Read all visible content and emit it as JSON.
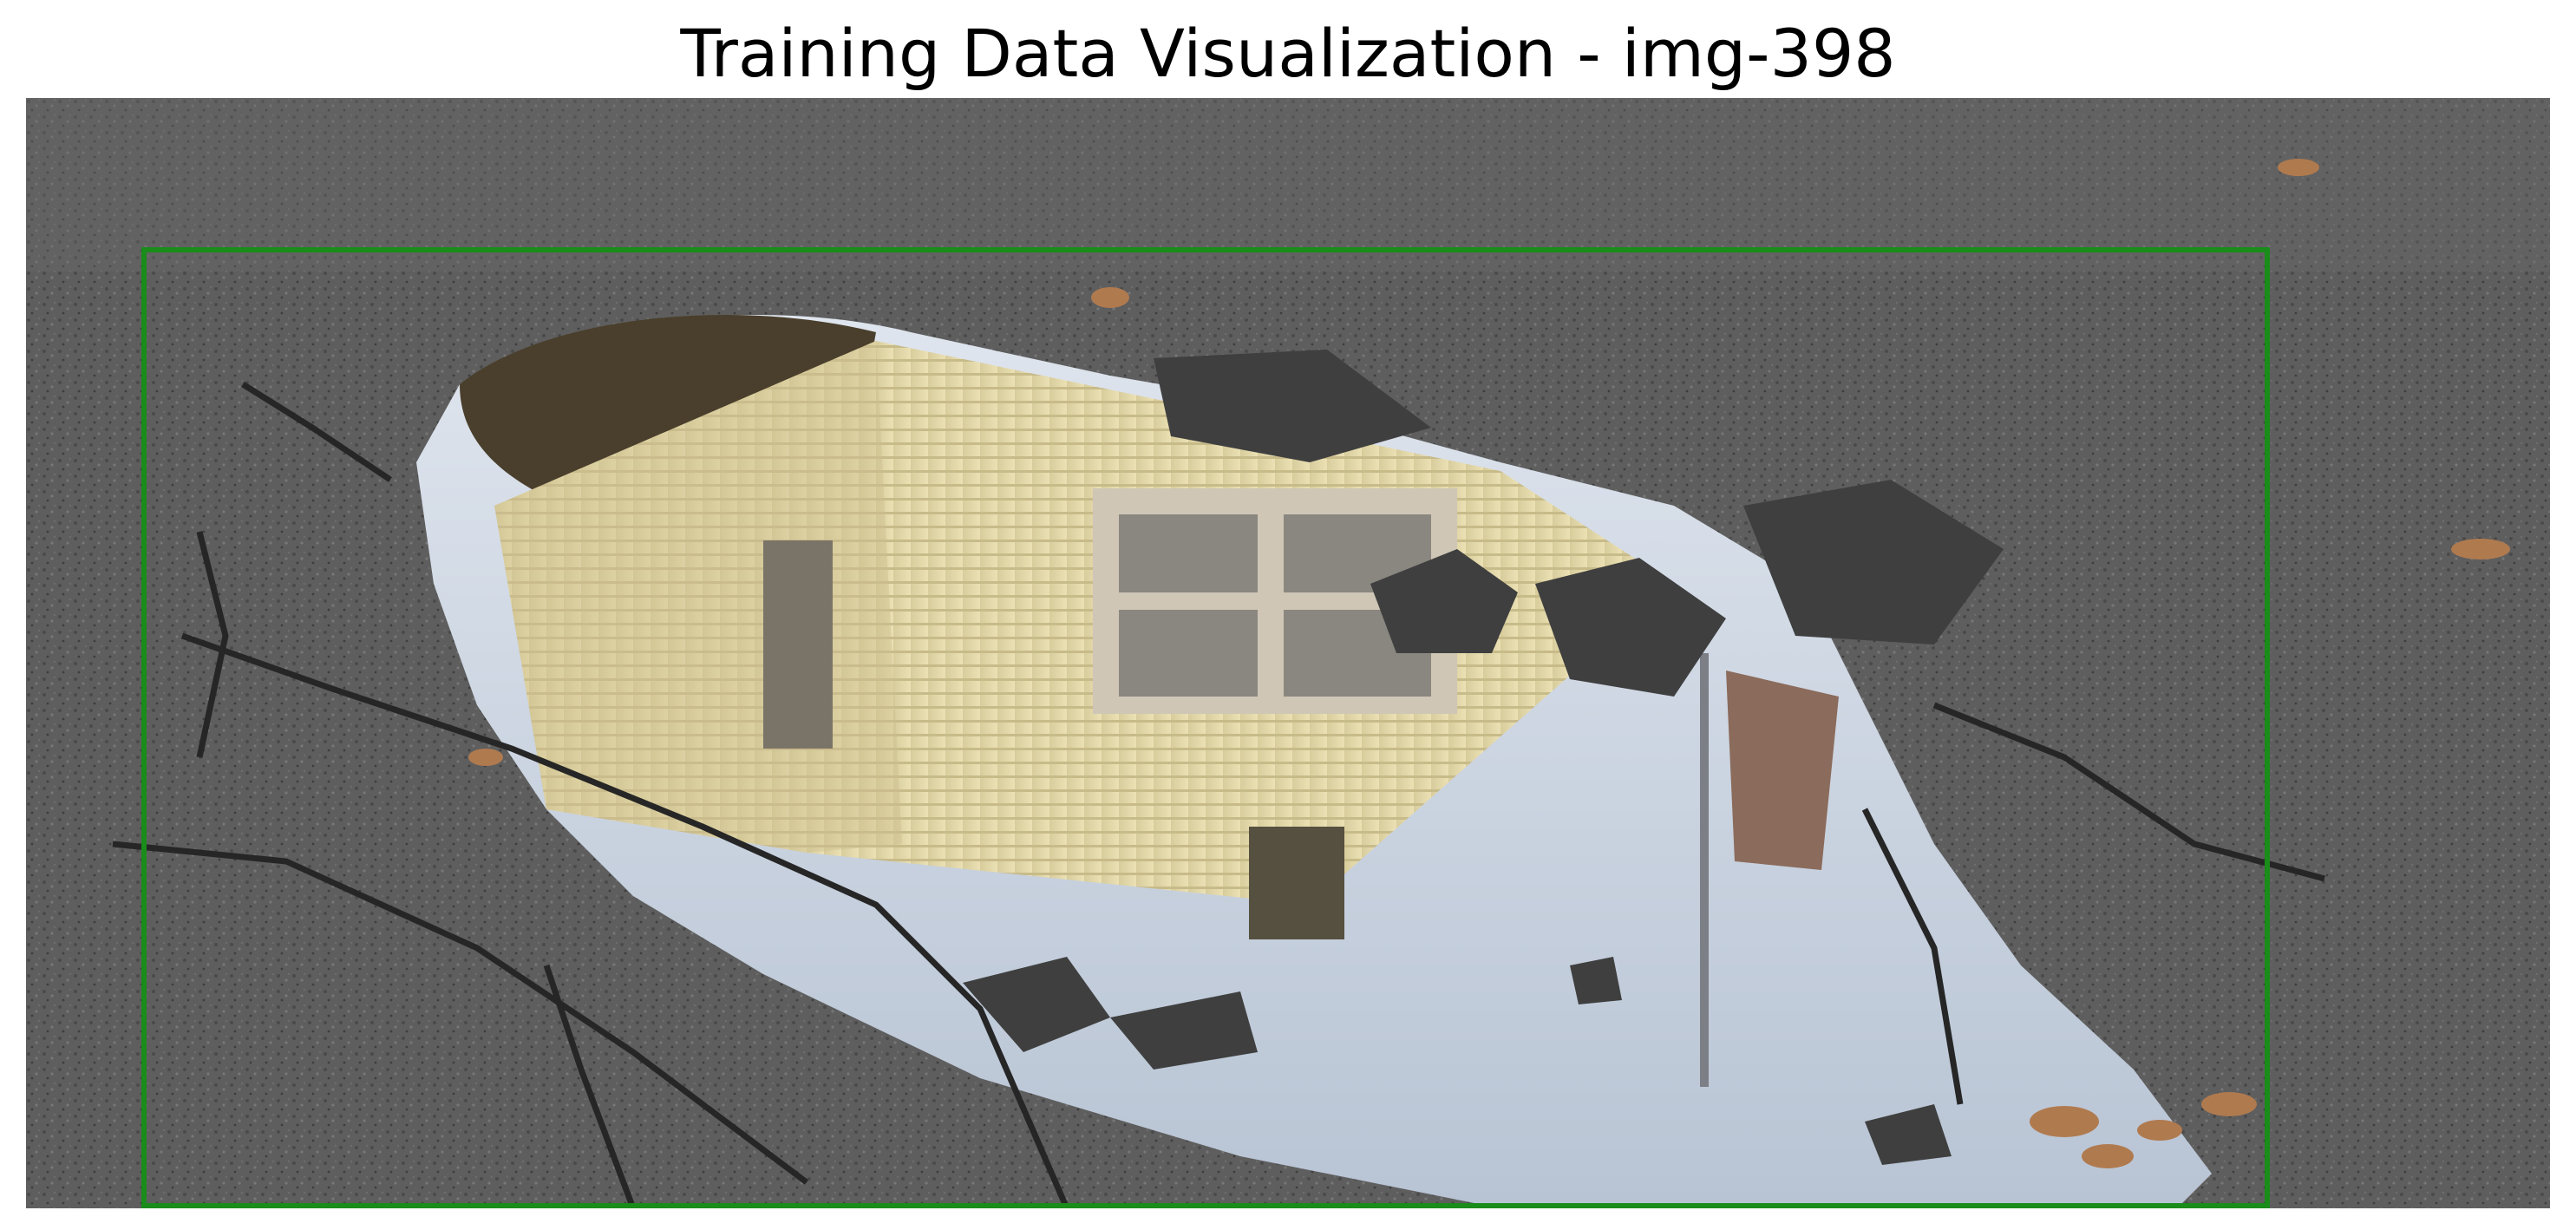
{
  "title": "Training Data Visualization - img-398",
  "image": {
    "scene": "pothole-puddle-reflection",
    "colors": {
      "asphalt": "#5e5e5e",
      "asphalt_dark": "#3c3c3c",
      "asphalt_light": "#7a7a7a",
      "water_sky": "#c9d3e0",
      "house_siding": "#e3d7a8",
      "window_frame": "#cfc6b6",
      "window_glass": "#8a8780",
      "leaves": "#b07a4f"
    }
  },
  "annotations": [
    {
      "color": "#1a8c1a"
    }
  ]
}
